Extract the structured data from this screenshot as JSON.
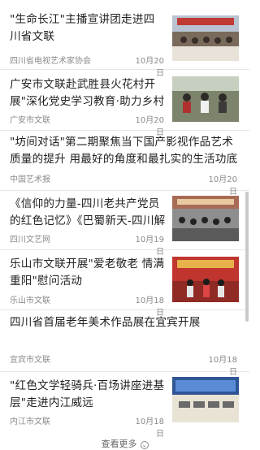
{
  "items": [
    {
      "title": "\"生命长江\"主播宣讲团走进四川省文联",
      "source": "四川省电视艺术家协会",
      "date": "10月20日",
      "has_thumbnail": true
    },
    {
      "title": "广安市文联赴武胜县火花村开展\"深化党史学习教育·助力乡村",
      "source": "广安市文联",
      "date": "10月20日",
      "has_thumbnail": true
    },
    {
      "title": "\"坊间对话\"第二期聚焦当下国产影视作品艺术质量的提升 用最好的角度和最扎实的生活功底讲述",
      "source": "中国艺术报",
      "date": "10月20日",
      "has_thumbnail": false
    },
    {
      "title": "《信仰的力量-四川老共产党员的红色记忆》《巴蜀新天-四川解放",
      "source": "四川文艺网",
      "date": "10月19日",
      "has_thumbnail": true
    },
    {
      "title": "乐山市文联开展\"爱老敬老 情满重阳\"慰问活动",
      "source": "乐山市文联",
      "date": "10月18日",
      "has_thumbnail": true
    },
    {
      "title": "四川省首届老年美术作品展在宜宾开展",
      "source": "宜宾市文联",
      "date": "10月18日",
      "has_thumbnail": false
    },
    {
      "title": "\"红色文学轻骑兵·百场讲座进基层\"走进内江威远",
      "source": "内江市文联",
      "date": "10月18日",
      "has_thumbnail": true
    }
  ],
  "load_more_label": "查看更多",
  "colors": {
    "text": "#1f1f1f",
    "meta": "#8a8a8a",
    "divider": "#e6e6e6"
  }
}
